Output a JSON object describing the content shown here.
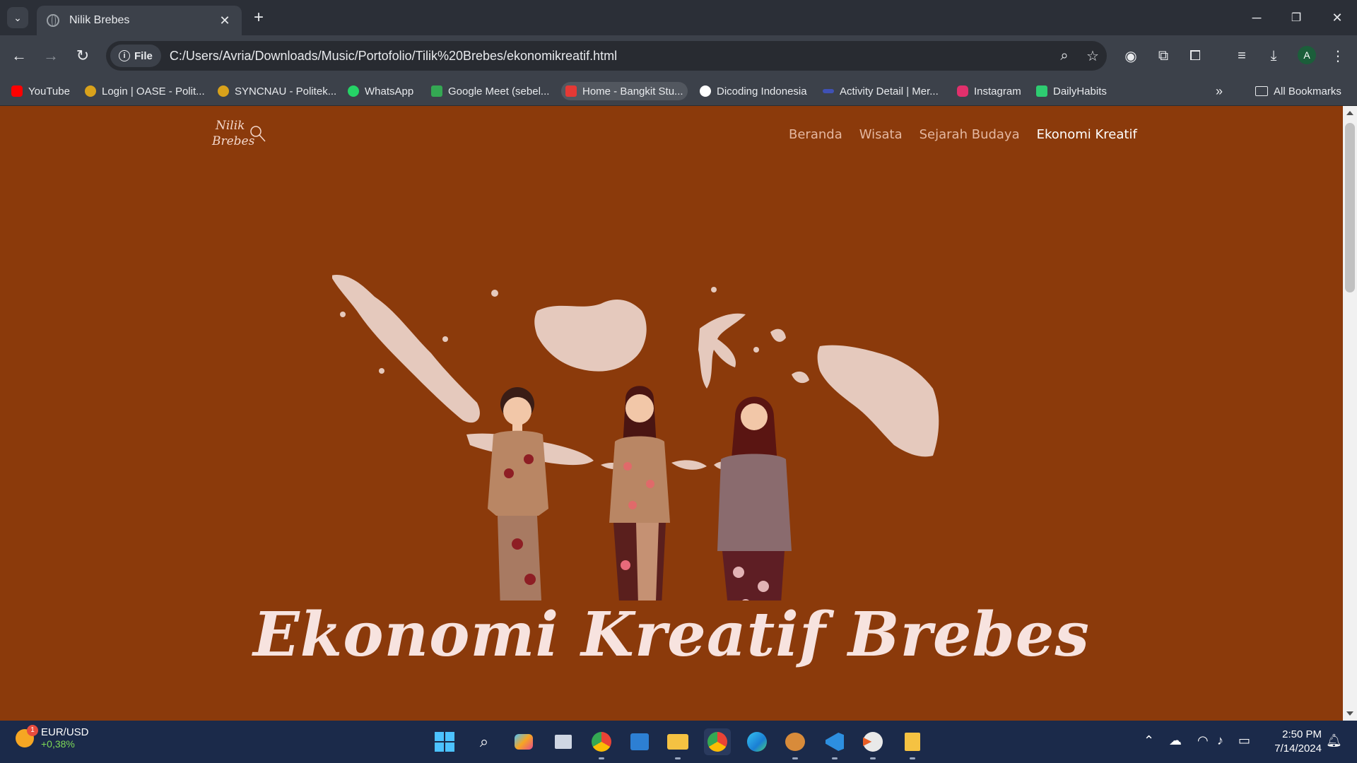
{
  "browser": {
    "tab_title": "Nilik Brebes",
    "omnibox_chip": "File",
    "url": "C:/Users/Avria/Downloads/Music/Portofolio/Tilik%20Brebes/ekonomikreatif.html",
    "bookmarks": [
      {
        "label": "YouTube",
        "icon": "youtube-icon",
        "color": "#ff0000"
      },
      {
        "label": "Login | OASE - Polit...",
        "icon": "oase-icon",
        "color": "#d9a21b"
      },
      {
        "label": "SYNCNAU - Politek...",
        "icon": "syncnau-icon",
        "color": "#d9a21b"
      },
      {
        "label": "WhatsApp",
        "icon": "whatsapp-icon",
        "color": "#25d366"
      },
      {
        "label": "Google Meet (sebel...",
        "icon": "google-meet-icon",
        "color": "#34a853"
      },
      {
        "label": "Home - Bangkit Stu...",
        "icon": "bangkit-icon",
        "color": "#e53935"
      },
      {
        "label": "Dicoding Indonesia",
        "icon": "dicoding-icon",
        "color": "#ffffff"
      },
      {
        "label": "Activity Detail | Mer...",
        "icon": "merdeka-icon",
        "color": "#3f51b5"
      },
      {
        "label": "Instagram",
        "icon": "instagram-icon",
        "color": "#e1306c"
      },
      {
        "label": "DailyHabits",
        "icon": "dailyhabits-icon",
        "color": "#2ecc71"
      }
    ],
    "all_bookmarks": "All Bookmarks"
  },
  "site": {
    "logo_line1": "Nilik",
    "logo_line2": "Brebes",
    "nav": [
      "Beranda",
      "Wisata",
      "Sejarah Budaya",
      "Ekonomi Kreatif"
    ],
    "current_nav": "Ekonomi Kreatif",
    "hero_title": "Ekonomi Kreatif Brebes",
    "colors": {
      "background": "#8b3a0b",
      "map": "#e5c9bd",
      "title": "#f7e3df"
    }
  },
  "taskbar": {
    "ticker_label": "EUR/USD",
    "ticker_change": "+0,38%",
    "notification_count": "1",
    "time": "2:50 PM",
    "date": "7/14/2024",
    "apps": [
      "start-icon",
      "search-icon",
      "copilot-icon",
      "task-view-icon",
      "chrome-icon",
      "store-icon",
      "file-explorer-icon",
      "chrome-profile-icon",
      "edge-icon",
      "game-icon",
      "vscode-icon",
      "media-player-icon",
      "notes-icon"
    ]
  }
}
